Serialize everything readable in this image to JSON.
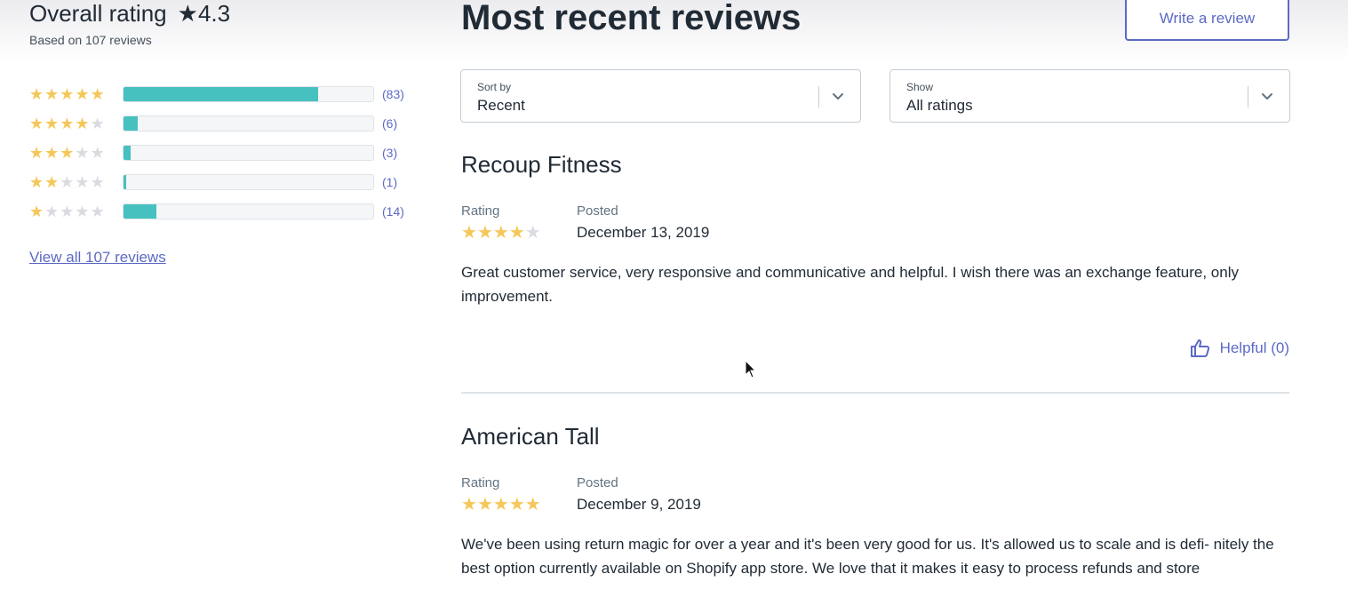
{
  "summary": {
    "title": "Overall rating",
    "avg_star": "★",
    "avg": "4.3",
    "based_on": "Based on 107 reviews",
    "distribution": [
      {
        "stars": 5,
        "count": "(83)",
        "fraction": 0.78
      },
      {
        "stars": 4,
        "count": "(6)",
        "fraction": 0.056
      },
      {
        "stars": 3,
        "count": "(3)",
        "fraction": 0.028
      },
      {
        "stars": 2,
        "count": "(1)",
        "fraction": 0.009
      },
      {
        "stars": 1,
        "count": "(14)",
        "fraction": 0.13
      }
    ],
    "view_all": "View all 107 reviews"
  },
  "main": {
    "title": "Most recent reviews",
    "write_button": "Write a review",
    "sort": {
      "label": "Sort by",
      "value": "Recent"
    },
    "show": {
      "label": "Show",
      "value": "All ratings"
    }
  },
  "labels": {
    "rating": "Rating",
    "posted": "Posted",
    "helpful": "Helpful (0)"
  },
  "reviews": [
    {
      "name": "Recoup Fitness",
      "rating": 4,
      "date": "December 13, 2019",
      "body": "Great customer service, very responsive and communicative and helpful. I wish there was an exchange feature, only improvement."
    },
    {
      "name": "American Tall",
      "rating": 5,
      "date": "December 9, 2019",
      "body": "We've been using return magic for over a year and it's been very good for us. It's allowed us to scale and is defi- nitely the best option currently available on Shopify app store. We love that it makes it easy to process refunds and store"
    }
  ],
  "colors": {
    "accent": "#5c6ac4",
    "bar_fill": "#47c1bf",
    "star_on": "#f5c75a",
    "star_off": "#d9dbe0"
  },
  "icons": {
    "helpful": "thumbs-up-icon",
    "dropdown": "chevron-down-icon",
    "star": "star-icon"
  }
}
